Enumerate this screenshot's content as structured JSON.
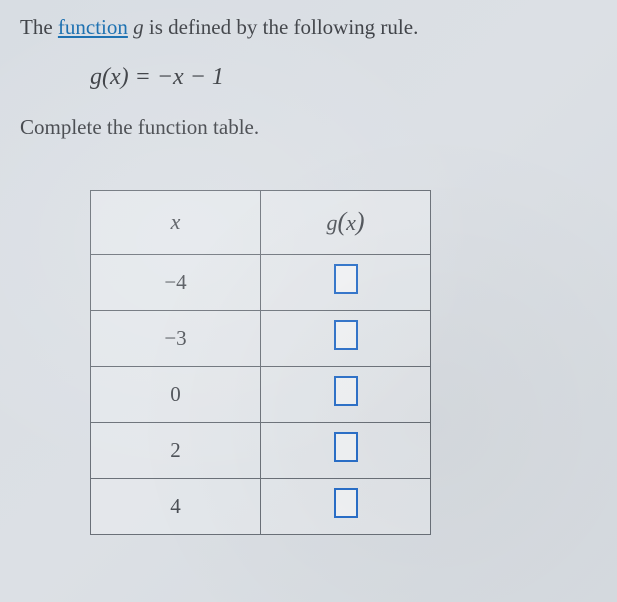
{
  "intro": {
    "prefix": "The ",
    "link": "function",
    "mid": " ",
    "var": "g",
    "suffix": " is defined by the following rule."
  },
  "formula": {
    "lhs_g": "g",
    "lhs_paren_open": "(",
    "lhs_x": "x",
    "lhs_paren_close": ")",
    "eq": " = ",
    "rhs": "−x − 1"
  },
  "instruction": "Complete the function table.",
  "table": {
    "headers": {
      "x": "x",
      "gx_g": "g",
      "gx_open": "(",
      "gx_x": "x",
      "gx_close": ")"
    },
    "rows": [
      {
        "x": "−4"
      },
      {
        "x": "−3"
      },
      {
        "x": "0"
      },
      {
        "x": "2"
      },
      {
        "x": "4"
      }
    ]
  },
  "chart_data": {
    "type": "table",
    "title": "Function table for g(x) = -x - 1",
    "columns": [
      "x",
      "g(x)"
    ],
    "rows": [
      {
        "x": -4,
        "g(x)": null
      },
      {
        "x": -3,
        "g(x)": null
      },
      {
        "x": 0,
        "g(x)": null
      },
      {
        "x": 2,
        "g(x)": null
      },
      {
        "x": 4,
        "g(x)": null
      }
    ]
  }
}
